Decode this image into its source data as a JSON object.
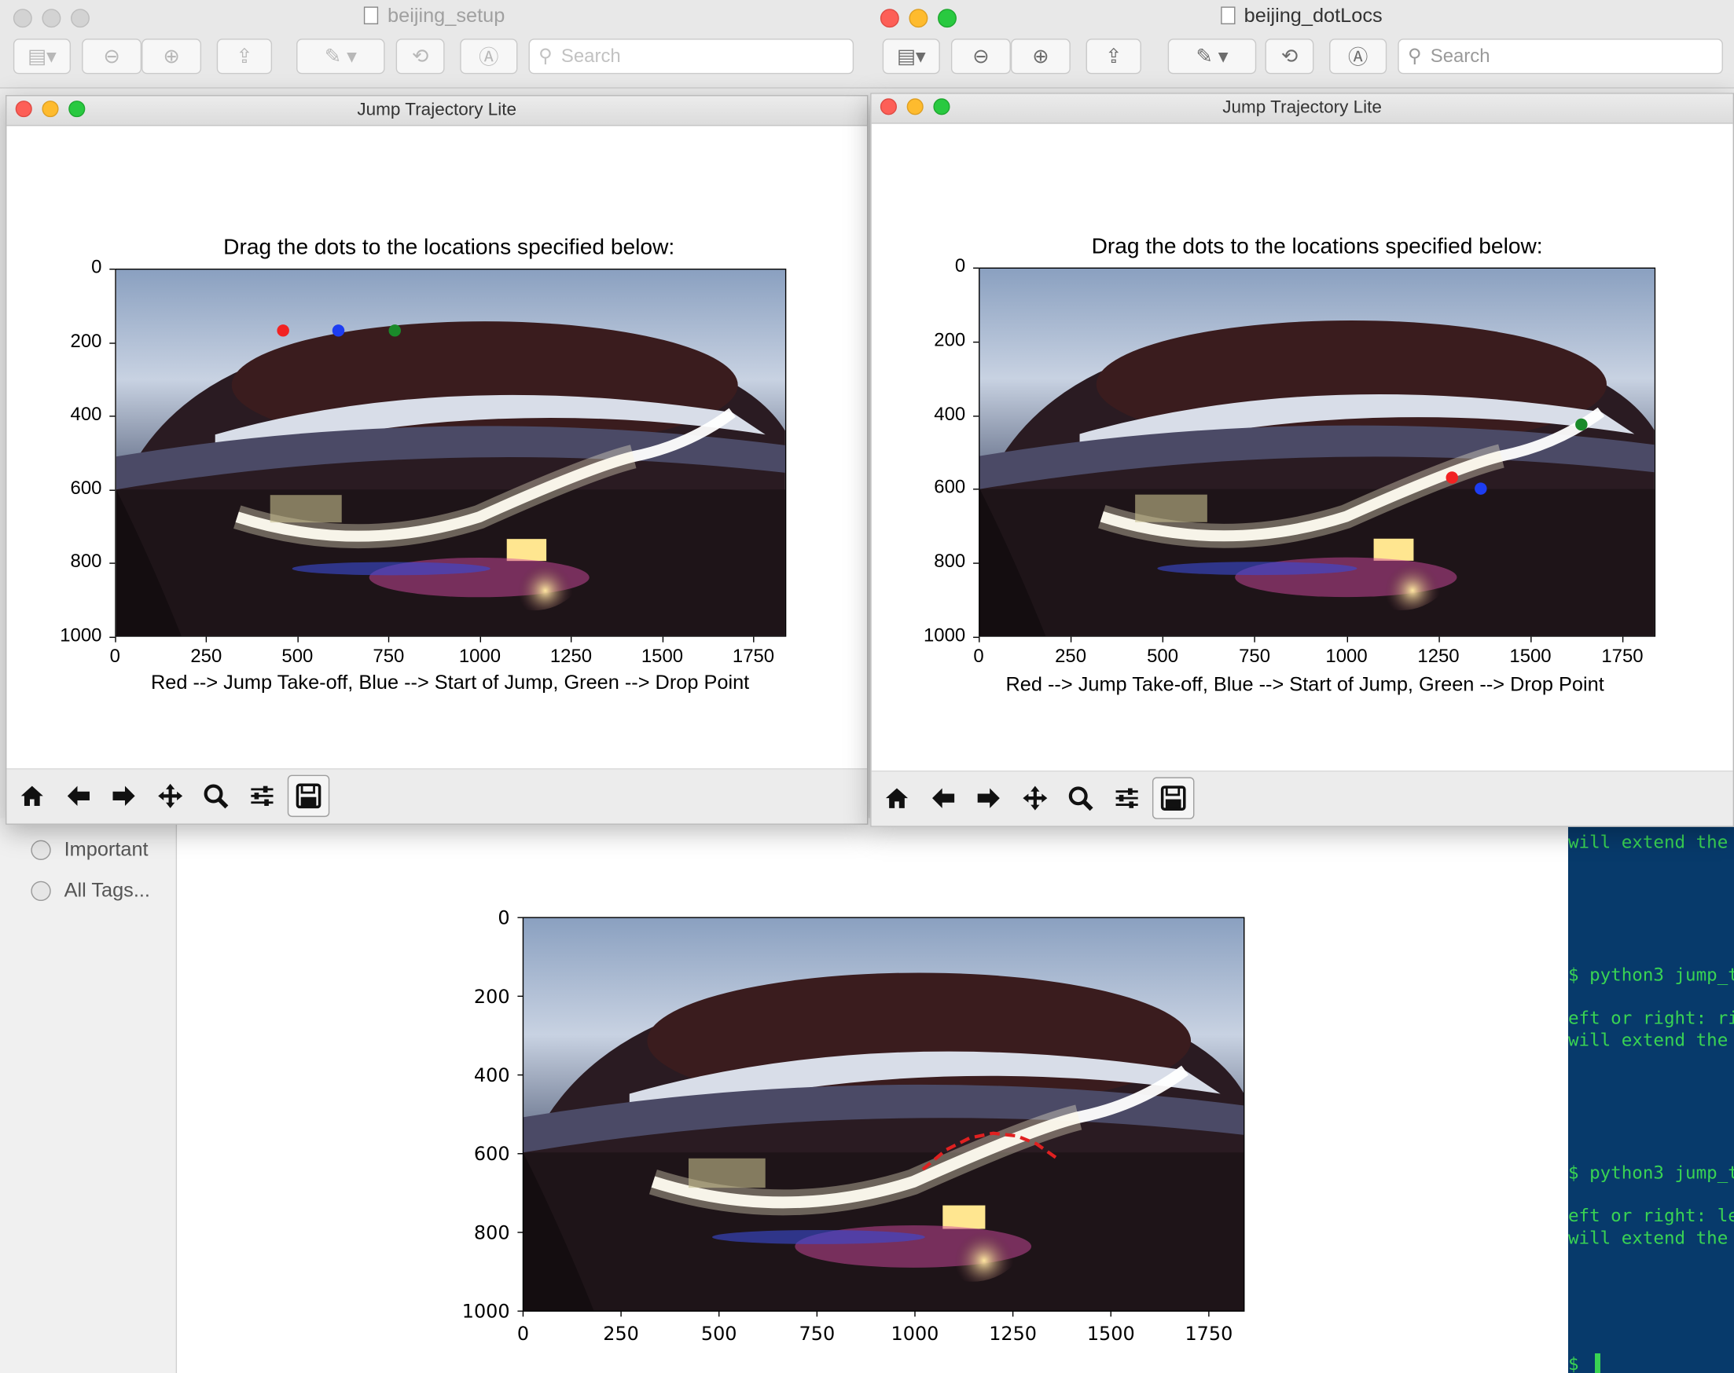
{
  "preview_windows": {
    "left": {
      "title": "beijing_setup",
      "search_placeholder": "Search"
    },
    "right": {
      "title": "beijing_dotLocs",
      "search_placeholder": "Search"
    }
  },
  "plot_windows": [
    {
      "window_title": "Jump Trajectory Lite",
      "plot_title": "Drag the dots to the locations specified below:",
      "xlabel": "Red --> Jump Take-off, Blue --> Start of Jump, Green --> Drop Point",
      "dots": [
        {
          "color": "red",
          "x": 460,
          "y": 168
        },
        {
          "color": "blue",
          "x": 612,
          "y": 168
        },
        {
          "color": "green",
          "x": 767,
          "y": 168
        }
      ]
    },
    {
      "window_title": "Jump Trajectory Lite",
      "plot_title": "Drag the dots to the locations specified below:",
      "xlabel": "Red --> Jump Take-off, Blue --> Start of Jump, Green --> Drop Point",
      "dots": [
        {
          "color": "red",
          "x": 1287,
          "y": 570
        },
        {
          "color": "blue",
          "x": 1365,
          "y": 600
        },
        {
          "color": "green",
          "x": 1640,
          "y": 425
        }
      ]
    }
  ],
  "axes": {
    "x_ticks": [
      "0",
      "250",
      "500",
      "750",
      "1000",
      "1250",
      "1500",
      "1750"
    ],
    "y_ticks": [
      "0",
      "200",
      "400",
      "600",
      "800",
      "1000"
    ]
  },
  "toolbar_icons": [
    "home-icon",
    "back-arrow-icon",
    "forward-arrow-icon",
    "pan-icon",
    "zoom-icon",
    "configure-subplots-icon",
    "save-icon"
  ],
  "sidebar_tags": [
    "Important",
    "All Tags..."
  ],
  "terminal_lines": [
    "will extend the",
    "$ python3 jump_t",
    "eft or right: ri",
    "will extend the",
    "$ python3 jump_t",
    "eft or right: le",
    "will extend the",
    "$ ▐"
  ],
  "chart_data": {
    "type": "line",
    "title": "",
    "xlabel": "",
    "ylabel": "",
    "xlim": [
      0,
      1840
    ],
    "ylim": [
      1000,
      0
    ],
    "series": [
      {
        "x": [
          1020,
          1080,
          1140,
          1200,
          1260,
          1310,
          1360
        ],
        "y": [
          640,
          590,
          560,
          548,
          555,
          575,
          610
        ]
      }
    ],
    "colors": {
      "series": "#e02020"
    }
  }
}
